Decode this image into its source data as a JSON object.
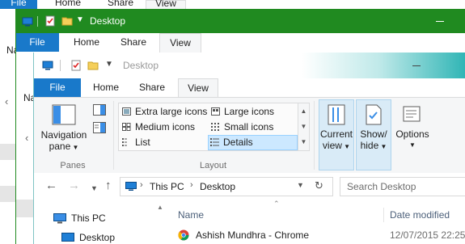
{
  "windows": {
    "back": {
      "tabs": {
        "file": "File",
        "home": "Home",
        "share": "Share",
        "view": "View"
      },
      "side_fragments": [
        "Na",
        "Na"
      ]
    },
    "middle": {
      "title": "Desktop",
      "tabs": {
        "file": "File",
        "home": "Home",
        "share": "Share",
        "view": "View"
      }
    },
    "front": {
      "title": "Desktop",
      "title_bar_color": "#2fb5b5",
      "tabs": {
        "file": "File",
        "home": "Home",
        "share": "Share",
        "view": "View"
      },
      "ribbon": {
        "panes": {
          "navigation_pane_line1": "Navigation",
          "navigation_pane_line2": "pane",
          "group_label": "Panes"
        },
        "layout": {
          "items": [
            "Extra large icons",
            "Large icons",
            "Medium icons",
            "Small icons",
            "List",
            "Details"
          ],
          "selected": "Details",
          "group_label": "Layout"
        },
        "current_view": {
          "line1": "Current",
          "line2": "view"
        },
        "show_hide": {
          "line1": "Show/",
          "line2": "hide"
        },
        "options": "Options"
      },
      "address": {
        "segments": [
          "This PC",
          "Desktop"
        ]
      },
      "search": {
        "placeholder": "Search Desktop"
      },
      "nav_pane": {
        "items": [
          "This PC",
          "Desktop"
        ]
      },
      "file_list": {
        "columns": {
          "name": "Name",
          "date_modified": "Date modified"
        },
        "rows": [
          {
            "name": "Ashish Mundhra - Chrome",
            "date": "12/07/2015 22:25"
          }
        ]
      }
    }
  },
  "colors": {
    "file_tab_blue": "#1979ca",
    "green_titlebar": "#208a20",
    "selection_blue": "#cce8ff"
  }
}
